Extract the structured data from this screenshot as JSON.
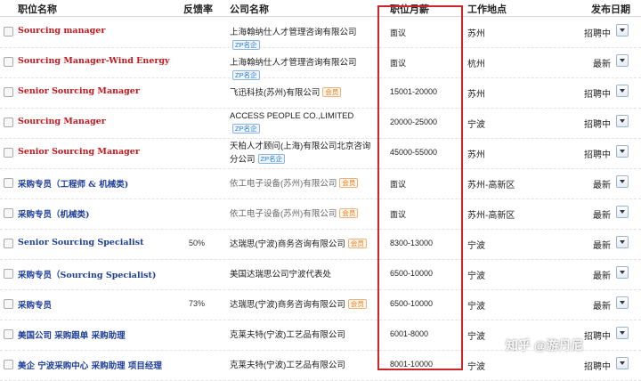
{
  "header": {
    "title": "职位名称",
    "company": "公司名称",
    "rate": "反馈率",
    "salary": "职位月薪",
    "location": "工作地点",
    "date": "发布日期"
  },
  "rows": [
    {
      "title": "Sourcing manager",
      "title_color": "red",
      "rate": "",
      "company": "上海翰纳仕人才管理咨询有限公司",
      "tag": "ZP名企",
      "tag_type": "zp",
      "company_gray": false,
      "salary": "面议",
      "location": "苏州",
      "status": "招聘中"
    },
    {
      "title": "Sourcing Manager-Wind Energy",
      "title_color": "red",
      "rate": "",
      "company": "上海翰纳仕人才管理咨询有限公司",
      "tag": "ZP名企",
      "tag_type": "zp",
      "company_gray": false,
      "salary": "面议",
      "location": "杭州",
      "status": "最新"
    },
    {
      "title": "Senior Sourcing Manager",
      "title_color": "red",
      "rate": "",
      "company": "飞迅科技(苏州)有限公司",
      "tag": "会员",
      "tag_type": "vip",
      "company_gray": false,
      "salary": "15001-20000",
      "location": "苏州",
      "status": "招聘中"
    },
    {
      "title": "Sourcing Manager",
      "title_color": "red",
      "rate": "",
      "company": "ACCESS PEOPLE CO.,LIMITED",
      "tag": "ZP名企",
      "tag_type": "zp",
      "company_gray": false,
      "salary": "20000-25000",
      "location": "宁波",
      "status": "招聘中"
    },
    {
      "title": "Senior Sourcing Manager",
      "title_color": "red",
      "rate": "",
      "company": "天柏人才顾问(上海)有限公司北京咨询分公司",
      "tag": "ZP名企",
      "tag_type": "zp",
      "company_gray": false,
      "salary": "45000-55000",
      "location": "苏州",
      "status": "招聘中"
    },
    {
      "title": "采购专员（工程师 & 机械类)",
      "title_color": "blue",
      "rate": "",
      "company": "依工电子设备(苏州)有限公司",
      "tag": "会员",
      "tag_type": "vip",
      "company_gray": true,
      "salary": "面议",
      "location": "苏州-高新区",
      "status": "最新"
    },
    {
      "title": "采购专员（机械类)",
      "title_color": "blue",
      "rate": "",
      "company": "依工电子设备(苏州)有限公司",
      "tag": "会员",
      "tag_type": "vip",
      "company_gray": true,
      "salary": "面议",
      "location": "苏州-高新区",
      "status": "最新"
    },
    {
      "title": "Senior Sourcing Specialist",
      "title_color": "blue",
      "rate": "50%",
      "company": "达瑞思(宁波)商务咨询有限公司",
      "tag": "会员",
      "tag_type": "vip",
      "company_gray": false,
      "salary": "8300-13000",
      "location": "宁波",
      "status": "最新"
    },
    {
      "title": "采购专员（Sourcing Specialist)",
      "title_color": "blue",
      "rate": "",
      "company": "美国达瑞思公司宁波代表处",
      "tag": "",
      "tag_type": "",
      "company_gray": false,
      "salary": "6500-10000",
      "location": "宁波",
      "status": "最新"
    },
    {
      "title": "采购专员",
      "title_color": "blue",
      "rate": "73%",
      "company": "达瑞思(宁波)商务咨询有限公司",
      "tag": "会员",
      "tag_type": "vip",
      "company_gray": false,
      "salary": "6500-10000",
      "location": "宁波",
      "status": "最新"
    },
    {
      "title": "美国公司 采购跟单 采购助理",
      "title_color": "blue",
      "rate": "",
      "company": "克莱夫特(宁波)工艺品有限公司",
      "tag": "",
      "tag_type": "",
      "company_gray": false,
      "salary": "6001-8000",
      "location": "宁波",
      "status": "招聘中"
    },
    {
      "title": "美企 宁波采购中心 采购助理 项目经理",
      "title_color": "blue",
      "rate": "",
      "company": "克莱夫特(宁波)工艺品有限公司",
      "tag": "",
      "tag_type": "",
      "company_gray": false,
      "salary": "8001-10000",
      "location": "宁波",
      "status": "招聘中"
    }
  ],
  "watermark": "知乎 @游丹尼"
}
